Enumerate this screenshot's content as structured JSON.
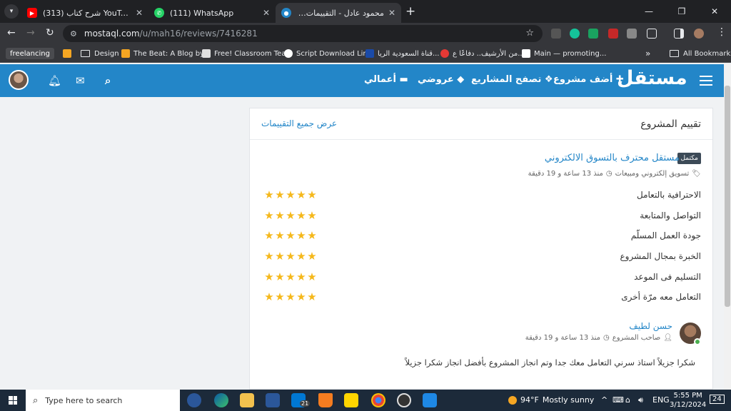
{
  "browser": {
    "tabs": [
      {
        "title": "(313) شرح كتاب YouTube - iq",
        "active": false
      },
      {
        "title": "(111) WhatsApp",
        "active": false
      },
      {
        "title": "محمود عادل - التقييمات | مستقل",
        "active": true
      }
    ],
    "url_host": "mostaql.com",
    "url_path": "/u/mah16/reviews/7416281",
    "bookmarks": [
      {
        "label": "freelancing",
        "type": "pill"
      },
      {
        "label": "",
        "type": "icon"
      },
      {
        "label": "Design",
        "type": "folder"
      },
      {
        "label": "The Beat: A Blog by...",
        "type": "link"
      },
      {
        "label": "Free! Classroom Tea...",
        "type": "link"
      },
      {
        "label": "Script Download Lin...",
        "type": "link"
      },
      {
        "label": "قناة السعودية الريا...",
        "type": "link"
      },
      {
        "label": "من الأرشيف.. دفاعًا ع...",
        "type": "link"
      },
      {
        "label": "Main — promoting...",
        "type": "link"
      }
    ],
    "more_bookmarks": "»",
    "all_bookmarks": "All Bookmarks"
  },
  "site": {
    "logo": "مستقل",
    "nav": [
      {
        "label": "أضف مشروع",
        "icon": "plus-icon",
        "glyph": "✚"
      },
      {
        "label": "تصفح المشاريع",
        "icon": "browse-icon",
        "glyph": "❖"
      },
      {
        "label": "عروضي",
        "icon": "offers-icon",
        "glyph": "◆"
      },
      {
        "label": "أعمالي",
        "icon": "briefcase-icon",
        "glyph": "▬"
      }
    ]
  },
  "review": {
    "card_title": "تقييم المشروع",
    "all_reviews_link": "عرض جميع التقييمات",
    "status_badge": "مكتمل",
    "project_title": "مستقل محترف بالتسوق الالكتروني",
    "category": "تسويق إلكتروني ومبيعات",
    "time_ago": "منذ 13 ساعة و 19 دقيقة",
    "criteria": [
      {
        "label": "الاحترافية بالتعامل",
        "rating": 5
      },
      {
        "label": "التواصل والمتابعة",
        "rating": 5
      },
      {
        "label": "جودة العمل المسلّم",
        "rating": 5
      },
      {
        "label": "الخبرة بمجال المشروع",
        "rating": 5
      },
      {
        "label": "التسليم فى الموعد",
        "rating": 5
      },
      {
        "label": "التعامل معه مرّة أخرى",
        "rating": 5
      }
    ],
    "reviewer_name": "حسن لطيف",
    "reviewer_role": "صاحب المشروع",
    "reviewer_time": "منذ 13 ساعة و 19 دقيقة",
    "comment": "شكرا جزيلاً استاذ سرني التعامل معك جدا وتم انجاز المشروع بأفضل انجاز شكرا جزيلاً"
  },
  "taskbar": {
    "search_placeholder": "Type here to search",
    "mail_badge": "21",
    "temperature": "94°F",
    "weather": "Mostly sunny",
    "language": "ENG",
    "time": "5:55 PM",
    "date": "3/12/2024",
    "notifications": "24"
  },
  "colors": {
    "brand": "#2386c8",
    "star": "#f5b81b",
    "badge": "#3c4a57"
  }
}
